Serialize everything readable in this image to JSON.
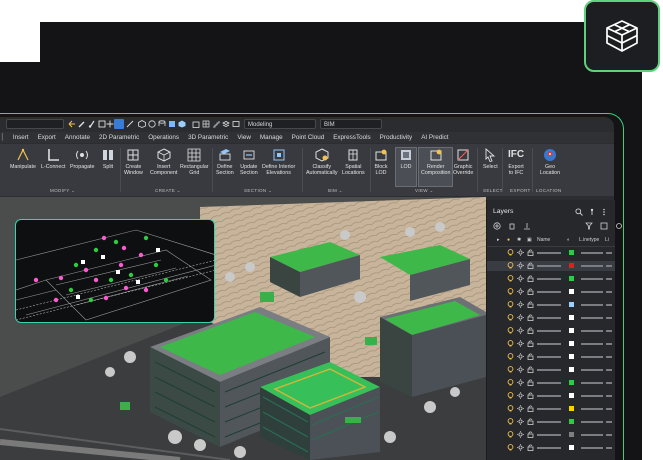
{
  "qat": {
    "workspace": "Modeling",
    "layer_combo": "BIM"
  },
  "menu": [
    "Insert",
    "Export",
    "Annotate",
    "2D Parametric",
    "Operations",
    "3D Parametric",
    "View",
    "Manage",
    "Point Cloud",
    "ExpressTools",
    "Productivity",
    "AI Predict"
  ],
  "ribbon": {
    "modify": {
      "label": "MODIFY",
      "buttons": [
        "Manipulate",
        "L-Connect",
        "Propagate",
        "Split"
      ]
    },
    "create": {
      "label": "CREATE",
      "buttons": [
        "Create\nWindow",
        "Insert\nComponent",
        "Rectangular\nGrid"
      ]
    },
    "section": {
      "label": "SECTION",
      "buttons": [
        "Define\nSection",
        "Update\nSection",
        "Define Interior\nElevations"
      ]
    },
    "bim": {
      "label": "BIM",
      "buttons": [
        "Classify\nAutomatically",
        "Spatial\nLocations"
      ]
    },
    "view": {
      "label": "VIEW",
      "buttons": [
        "Block\nLOD",
        "LOD",
        "Render\nComposition",
        "Graphic\nOverride"
      ]
    },
    "select": {
      "label": "SELECT",
      "buttons": [
        "Select"
      ]
    },
    "export": {
      "label": "EXPORT",
      "buttons": [
        "Export\nto IFC"
      ]
    },
    "location": {
      "label": "LOCATION",
      "buttons": [
        "Geo\nLocation"
      ]
    }
  },
  "ifc_text": "IFC",
  "layers": {
    "title": "Layers",
    "columns": {
      "name": "Name",
      "linetype": "L.inetype",
      "lw": "Li"
    },
    "row_colors": [
      "#2ecc40",
      "#e02020",
      "#2ecc40",
      "#ffffff",
      "#9bd1ff",
      "#ffffff",
      "#ffffff",
      "#ffffff",
      "#ffffff",
      "#ffffff",
      "#2ecc40",
      "#ffffff",
      "#ffd200",
      "#2ecc40",
      "#7f7f7f",
      "#ffffff"
    ]
  },
  "colors": {
    "accent_green": "#3ad27c",
    "inset_border": "#3ad2b0",
    "selection": "#3a7bd5"
  }
}
